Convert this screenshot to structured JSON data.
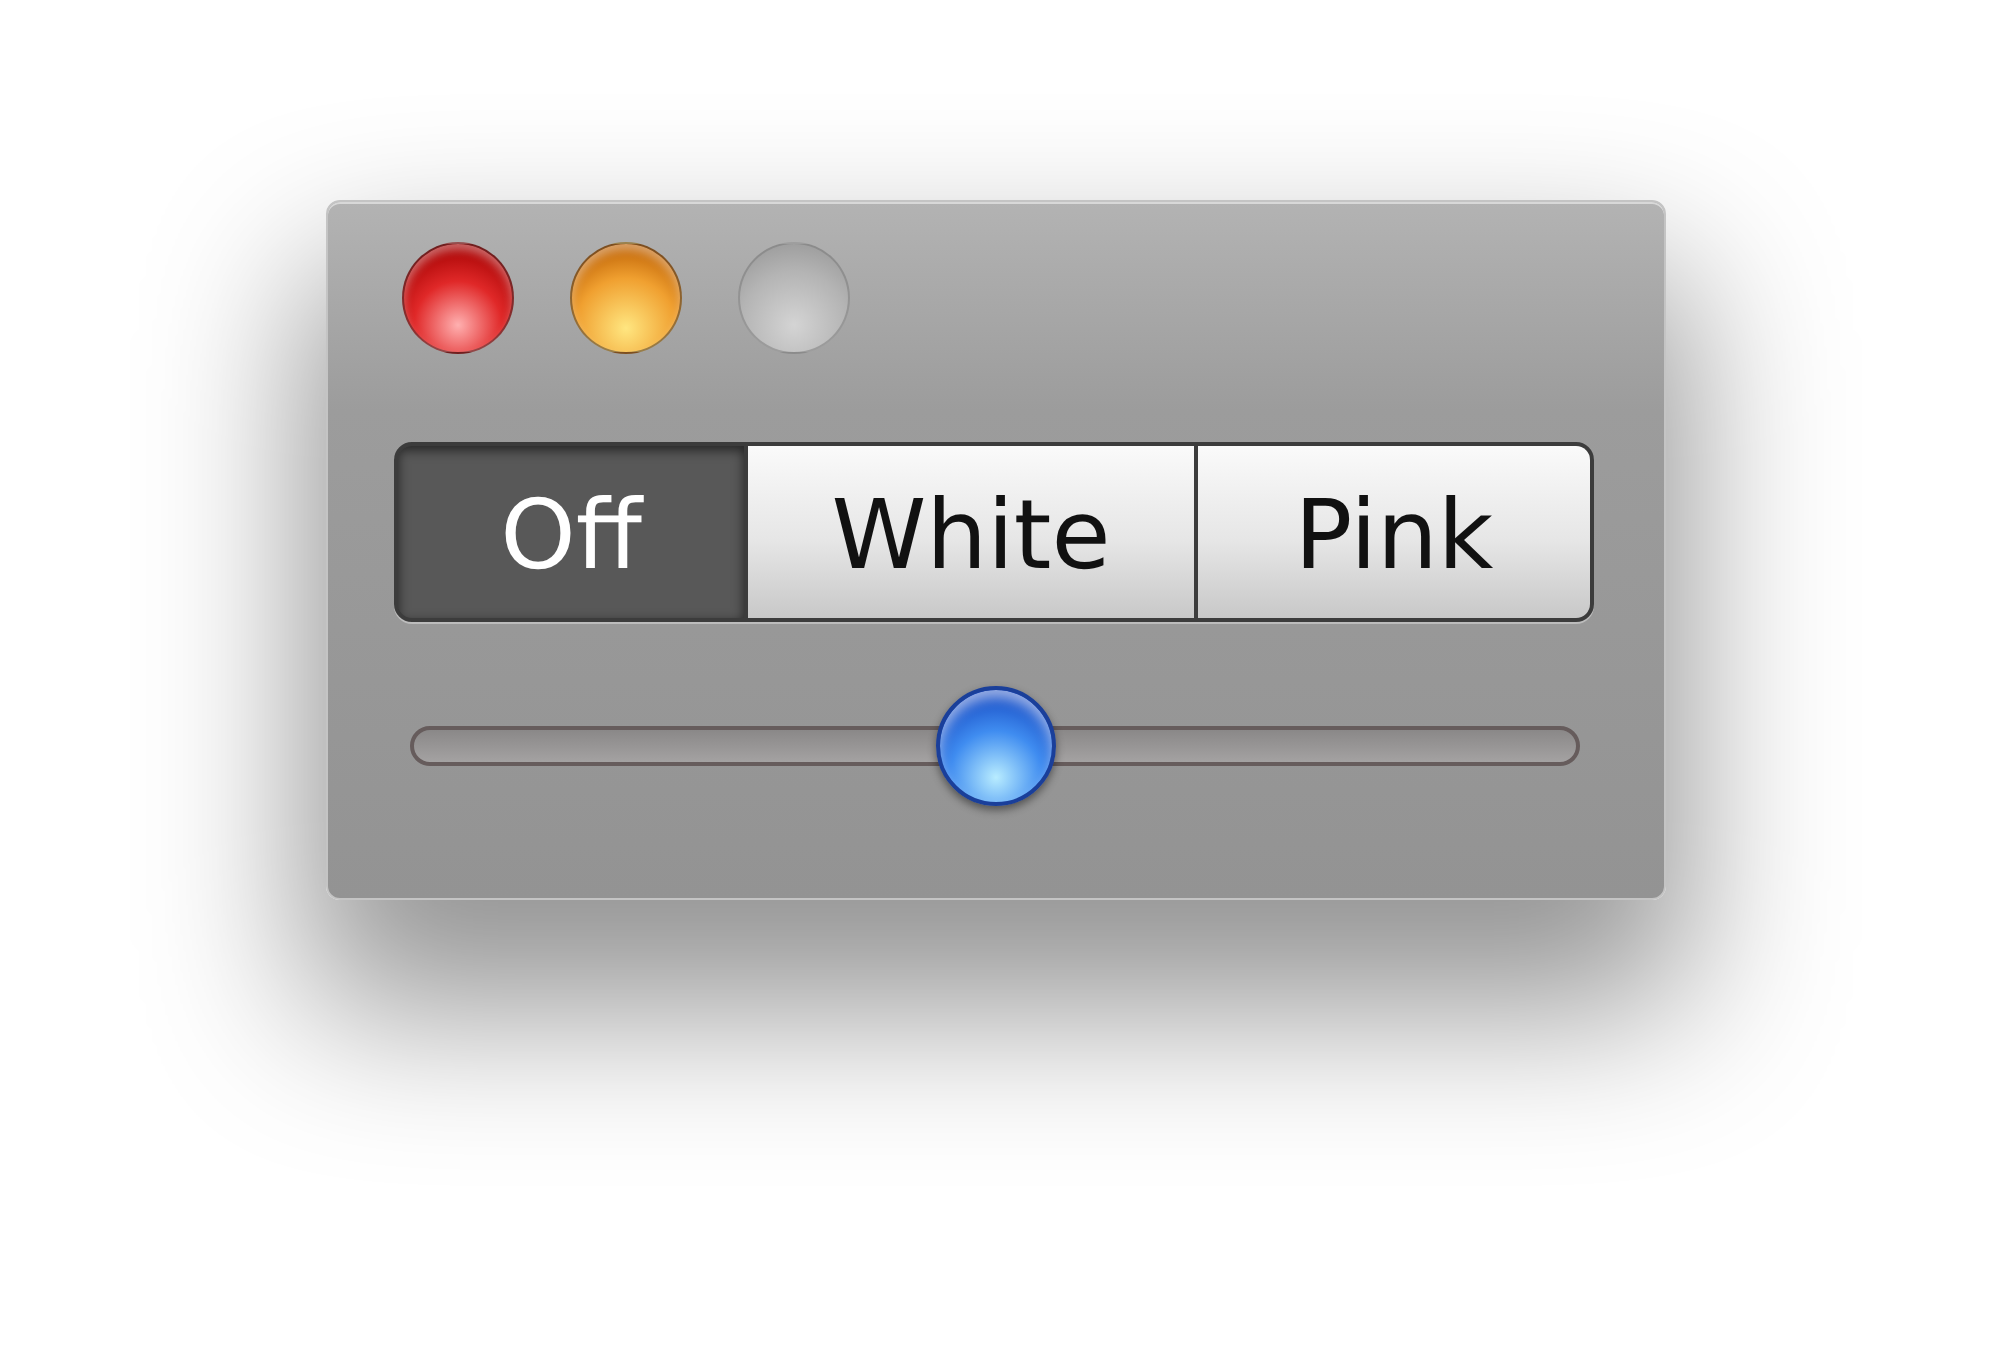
{
  "window": {
    "controls": [
      {
        "kind": "close",
        "disabled": false
      },
      {
        "kind": "minimize",
        "disabled": false
      },
      {
        "kind": "zoom",
        "disabled": true
      }
    ]
  },
  "segments": [
    {
      "label": "Off",
      "selected": true
    },
    {
      "label": "White",
      "selected": false
    },
    {
      "label": "Pink",
      "selected": false
    }
  ],
  "slider": {
    "level": 0.5
  }
}
